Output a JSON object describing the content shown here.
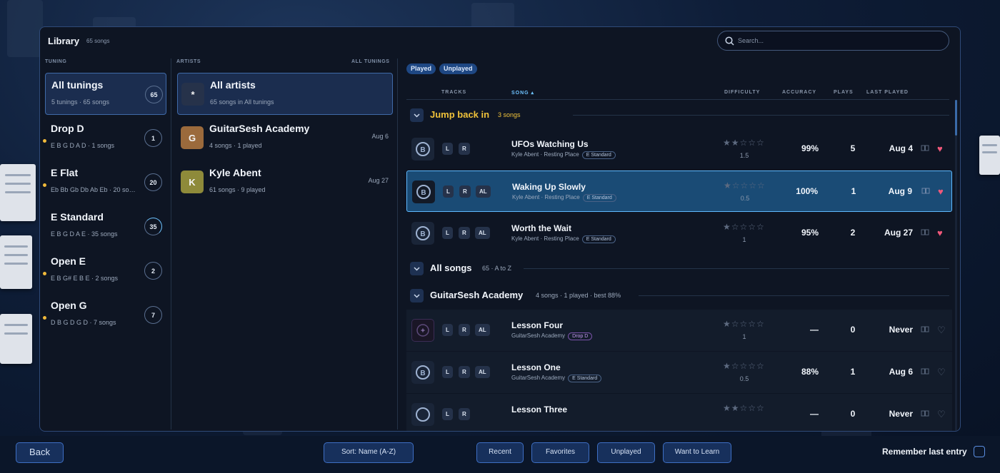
{
  "colors": {
    "accent": "#6ec3ff",
    "highlight": "#f0c23a",
    "favorite": "#f0587a",
    "panel": "#0e1523",
    "button": "#17305c"
  },
  "library": {
    "title": "Library",
    "count": "65 songs"
  },
  "search": {
    "placeholder": "Search..."
  },
  "tuning": {
    "label": "TUNING",
    "items": [
      {
        "name": "All tunings",
        "sub": "5 tunings · 65 songs",
        "count": "65",
        "selected": true,
        "new_dot": false
      },
      {
        "name": "Drop D",
        "sub": "E B G D A D · 1 songs",
        "count": "1",
        "selected": false,
        "new_dot": true
      },
      {
        "name": "E Flat",
        "sub": "Eb Bb Gb Db Ab Eb · 20 songs",
        "count": "20",
        "selected": false,
        "new_dot": true
      },
      {
        "name": "E Standard",
        "sub": "E B G D A E · 35 songs",
        "count": "35",
        "selected": false,
        "new_dot": false
      },
      {
        "name": "Open E",
        "sub": "E B G# E B E · 2 songs",
        "count": "2",
        "selected": false,
        "new_dot": true
      },
      {
        "name": "Open G",
        "sub": "D B G D G D · 7 songs",
        "count": "7",
        "selected": false,
        "new_dot": true
      }
    ]
  },
  "artists": {
    "label": "ARTISTS",
    "filter": "ALL TUNINGS",
    "items": [
      {
        "initial": "*",
        "name": "All artists",
        "sub": "65 songs in All tunings",
        "date": "",
        "color": "#26324a"
      },
      {
        "initial": "G",
        "name": "GuitarSesh Academy",
        "sub": "4 songs · 1 played",
        "date": "Aug 6",
        "color": "#9b6a3c"
      },
      {
        "initial": "K",
        "name": "Kyle Abent",
        "sub": "61 songs · 9 played",
        "date": "Aug 27",
        "color": "#8e8a3a"
      }
    ]
  },
  "filters": [
    "Played",
    "Unplayed"
  ],
  "columns": {
    "tracks": "TRACKS",
    "song": "SONG ▴",
    "difficulty": "DIFFICULTY",
    "accuracy": "ACCURACY",
    "plays": "PLAYS",
    "last_played": "LAST PLAYED"
  },
  "groups": [
    {
      "title": "Jump back in",
      "sub": "3 songs"
    },
    {
      "title": "All songs",
      "sub": "65 · A to Z"
    },
    {
      "title": "GuitarSesh Academy",
      "sub": "4 songs · 1 played · best 88%"
    }
  ],
  "songs": [
    {
      "title": "UFOs Watching Us",
      "artist": "Kyle Abent · Resting Place",
      "tuning": "E Standard",
      "tracks": [
        "L",
        "R"
      ],
      "stars": "★★☆☆☆",
      "difficulty": "1.5",
      "accuracy": "99%",
      "plays": "5",
      "last": "Aug 4",
      "fav": "♥"
    },
    {
      "title": "Waking Up Slowly",
      "artist": "Kyle Abent · Resting Place",
      "tuning": "E Standard",
      "tracks": [
        "L",
        "R",
        "AL"
      ],
      "stars": "★☆☆☆☆",
      "difficulty": "0.5",
      "accuracy": "100%",
      "plays": "1",
      "last": "Aug 9",
      "fav": "♥"
    },
    {
      "title": "Worth the Wait",
      "artist": "Kyle Abent · Resting Place",
      "tuning": "E Standard",
      "tracks": [
        "L",
        "R",
        "AL"
      ],
      "stars": "★☆☆☆☆",
      "difficulty": "1",
      "accuracy": "95%",
      "plays": "2",
      "last": "Aug 27",
      "fav": "♥"
    },
    {
      "title": "Lesson Four",
      "artist": "GuitarSesh Academy",
      "tuning": "Drop D",
      "tracks": [
        "L",
        "R",
        "AL"
      ],
      "stars": "★☆☆☆☆",
      "difficulty": "1",
      "accuracy": "—",
      "plays": "0",
      "last": "Never",
      "fav": "♡"
    },
    {
      "title": "Lesson One",
      "artist": "GuitarSesh Academy",
      "tuning": "E Standard",
      "tracks": [
        "L",
        "R",
        "AL"
      ],
      "stars": "★☆☆☆☆",
      "difficulty": "0.5",
      "accuracy": "88%",
      "plays": "1",
      "last": "Aug 6",
      "fav": "♡"
    },
    {
      "title": "Lesson Three",
      "artist": "",
      "tuning": "",
      "tracks": [
        "L",
        "R"
      ],
      "stars": "★★☆☆☆",
      "difficulty": "",
      "accuracy": "—",
      "plays": "0",
      "last": "Never",
      "fav": "♡"
    }
  ],
  "bottom": {
    "back": "Back",
    "sort": "Sort: Name (A-Z)",
    "recent": "Recent",
    "favorites": "Favorites",
    "unplayed": "Unplayed",
    "want": "Want to Learn",
    "remember": "Remember last entry"
  }
}
